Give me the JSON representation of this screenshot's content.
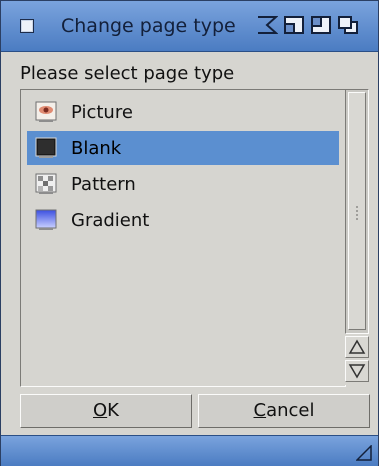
{
  "window": {
    "title": "Change page type"
  },
  "dialog": {
    "prompt": "Please select page type",
    "items": [
      {
        "label": "Picture",
        "icon": "picture-icon"
      },
      {
        "label": "Blank",
        "icon": "blank-page-icon"
      },
      {
        "label": "Pattern",
        "icon": "pattern-icon"
      },
      {
        "label": "Gradient",
        "icon": "gradient-icon"
      }
    ],
    "selected": "Blank"
  },
  "buttons": {
    "ok_underlined": "O",
    "ok_rest": "K",
    "cancel_underlined": "C",
    "cancel_rest": "ancel"
  },
  "colors": {
    "titlebar": "#5b8ad0",
    "selection": "#5b8fd0",
    "panel": "#d6d5d0"
  }
}
